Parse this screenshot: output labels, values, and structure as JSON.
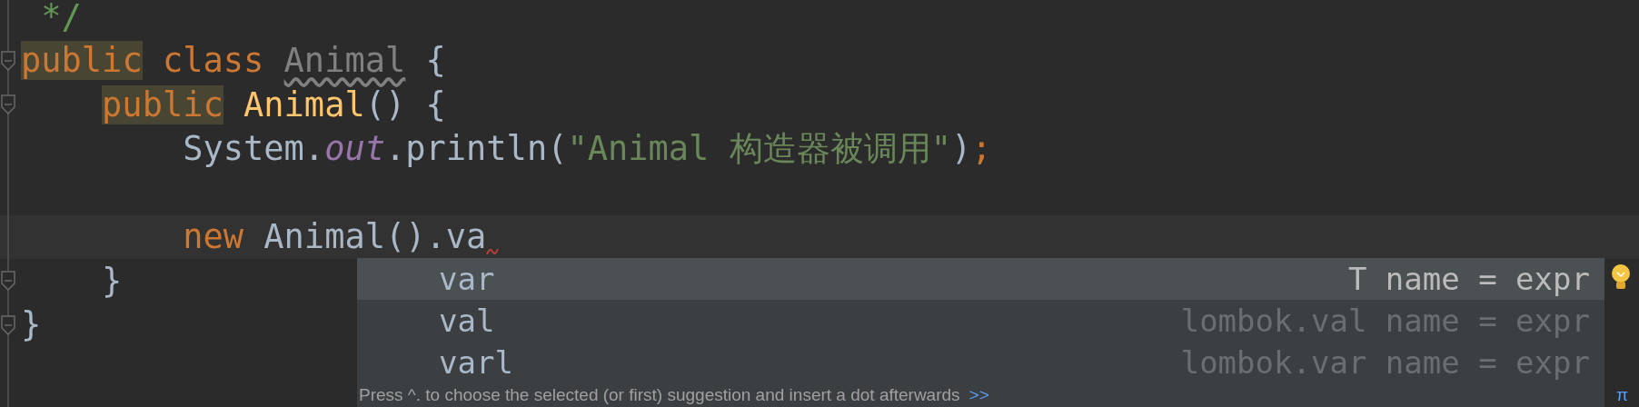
{
  "code": [
    {
      "tokens": [
        {
          "text": " */",
          "kind": "comment"
        }
      ],
      "current": false
    },
    {
      "tokens": [
        {
          "text": "public",
          "kind": "keyword-highlighted"
        },
        {
          "text": " class ",
          "kind": "keyword"
        },
        {
          "text": "Animal",
          "kind": "unused"
        },
        {
          "text": " {",
          "kind": "plain"
        }
      ],
      "current": false,
      "closing": "}",
      "children": [
        {
          "tokens": [
            {
              "text": "public",
              "kind": "keyword-highlighted"
            },
            {
              "text": " Animal",
              "kind": "declaration"
            },
            {
              "text": "() {",
              "kind": "plain"
            }
          ],
          "current": false,
          "closing": "}",
          "children": [
            {
              "tokens": [
                {
                  "text": "System.",
                  "kind": "plain"
                },
                {
                  "text": "out",
                  "kind": "field"
                },
                {
                  "text": ".println(",
                  "kind": "plain"
                },
                {
                  "text": "\"Animal 构造器被调用\"",
                  "kind": "string"
                },
                {
                  "text": ")",
                  "kind": "plain"
                },
                {
                  "text": ";",
                  "kind": "keyword"
                }
              ],
              "current": false
            },
            {
              "current": false
            },
            {
              "tokens": [
                {
                  "text": "new",
                  "kind": "keyword"
                },
                {
                  "text": " Animal().va",
                  "kind": "plain"
                }
              ],
              "current": true
            }
          ]
        }
      ]
    }
  ],
  "completion": {
    "items": [
      {
        "label": "var",
        "type_text": "T name = expr",
        "selected": true
      },
      {
        "label": "val",
        "type_text": "lombok.val name = expr",
        "selected": false
      },
      {
        "label": "varl",
        "type_text": "lombok.var name = expr",
        "selected": false
      }
    ],
    "hint": "Press ^. to choose the selected (or first) suggestion and insert a dot afterwards",
    "hint_link": ">>",
    "corner_symbol": "π"
  }
}
